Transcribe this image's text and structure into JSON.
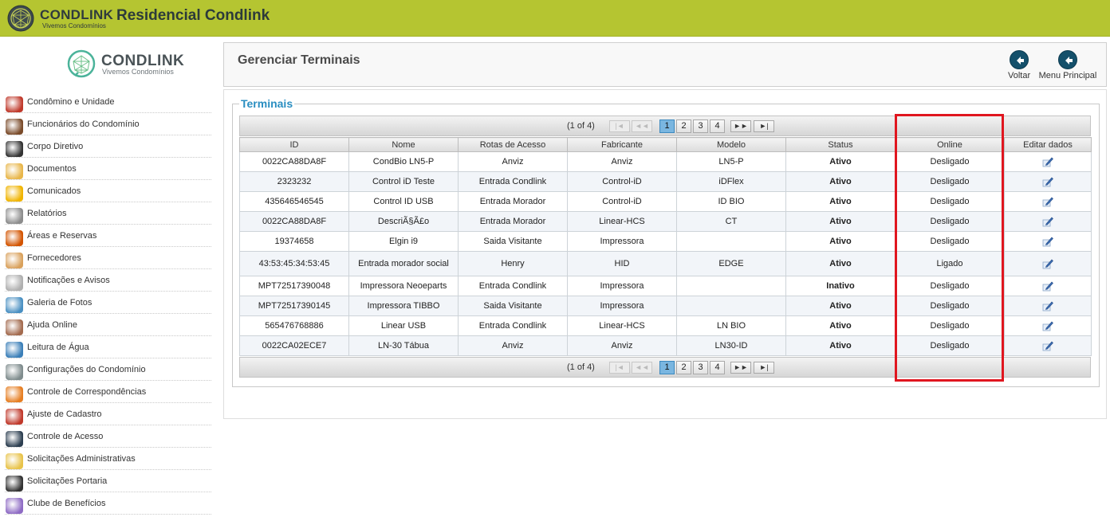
{
  "topbar": {
    "brand_name": "CONDLINK",
    "brand_tagline": "Vivemos Condomínios",
    "title": "Residencial Condlink"
  },
  "sidebar": {
    "logo_name": "CONDLINK",
    "logo_tagline": "Vivemos Condomínios",
    "items": [
      {
        "label": "Condômino e Unidade",
        "icon": "people-house-icon",
        "color": "#c0392b"
      },
      {
        "label": "Funcionários do Condomínio",
        "icon": "staff-icon",
        "color": "#7a4b2a"
      },
      {
        "label": "Corpo Diretivo",
        "icon": "director-icon",
        "color": "#333333"
      },
      {
        "label": "Documentos",
        "icon": "folder-icon",
        "color": "#e8b64a"
      },
      {
        "label": "Comunicados",
        "icon": "alert-icon",
        "color": "#f0b400"
      },
      {
        "label": "Relatórios",
        "icon": "report-icon",
        "color": "#8c8c8c"
      },
      {
        "label": "Áreas e Reservas",
        "icon": "calendar-icon",
        "color": "#d35400"
      },
      {
        "label": "Fornecedores",
        "icon": "handshake-icon",
        "color": "#d9a15c"
      },
      {
        "label": "Notificações e Avisos",
        "icon": "notification-icon",
        "color": "#b0b0b0"
      },
      {
        "label": "Galeria de Fotos",
        "icon": "photos-icon",
        "color": "#4a90c2"
      },
      {
        "label": "Ajuda Online",
        "icon": "help-icon",
        "color": "#a36b4f"
      },
      {
        "label": "Leitura de Água",
        "icon": "water-icon",
        "color": "#3b7fb8"
      },
      {
        "label": "Configurações do Condomínio",
        "icon": "settings-icon",
        "color": "#7f8c8d"
      },
      {
        "label": "Controle de Correspondências",
        "icon": "mail-icon",
        "color": "#e67e22"
      },
      {
        "label": "Ajuste de Cadastro",
        "icon": "briefcase-icon",
        "color": "#c0392b"
      },
      {
        "label": "Controle de Acesso",
        "icon": "access-icon",
        "color": "#2c3e50"
      },
      {
        "label": "Solicitações Administrativas",
        "icon": "request-icon",
        "color": "#e8c34a"
      },
      {
        "label": "Solicitações Portaria",
        "icon": "pen-icon",
        "color": "#333333"
      },
      {
        "label": "Clube de Benefícios",
        "icon": "gift-icon",
        "color": "#8e6bc4"
      }
    ]
  },
  "header": {
    "page_title": "Gerenciar Terminais",
    "back_label": "Voltar",
    "main_menu_label": "Menu Principal"
  },
  "section": {
    "legend": "Terminais"
  },
  "pager": {
    "info": "(1 of 4)",
    "first": "|◄",
    "prev": "◄◄",
    "next": "►►",
    "last": "►|",
    "pages": [
      "1",
      "2",
      "3",
      "4"
    ],
    "current_page": "1"
  },
  "table": {
    "columns": [
      "ID",
      "Nome",
      "Rotas de Acesso",
      "Fabricante",
      "Modelo",
      "Status",
      "Online",
      "Editar dados"
    ],
    "rows": [
      {
        "id": "0022CA88DA8F",
        "nome": "CondBio LN5-P",
        "rotas": "Anviz",
        "fabricante": "Anviz",
        "modelo": "LN5-P",
        "status": "Ativo",
        "online": "Desligado"
      },
      {
        "id": "2323232",
        "nome": "Control iD Teste",
        "rotas": "Entrada Condlink",
        "fabricante": "Control-iD",
        "modelo": "iDFlex",
        "status": "Ativo",
        "online": "Desligado"
      },
      {
        "id": "435646546545",
        "nome": "Control ID USB",
        "rotas": "Entrada Morador",
        "fabricante": "Control-iD",
        "modelo": "ID BIO",
        "status": "Ativo",
        "online": "Desligado"
      },
      {
        "id": "0022CA88DA8F",
        "nome": "DescriÃ§Ã£o",
        "rotas": "Entrada Morador",
        "fabricante": "Linear-HCS",
        "modelo": "CT",
        "status": "Ativo",
        "online": "Desligado"
      },
      {
        "id": "19374658",
        "nome": "Elgin i9",
        "rotas": "Saida Visitante",
        "fabricante": "Impressora",
        "modelo": "",
        "status": "Ativo",
        "online": "Desligado"
      },
      {
        "id": "43:53:45:34:53:45",
        "nome": "Entrada morador social",
        "rotas": "Henry",
        "fabricante": "HID",
        "modelo": "EDGE",
        "status": "Ativo",
        "online": "Ligado"
      },
      {
        "id": "MPT72517390048",
        "nome": "Impressora Neoeparts",
        "rotas": "Entrada Condlink",
        "fabricante": "Impressora",
        "modelo": "",
        "status": "Inativo",
        "online": "Desligado"
      },
      {
        "id": "MPT72517390145",
        "nome": "Impressora TIBBO",
        "rotas": "Saida Visitante",
        "fabricante": "Impressora",
        "modelo": "",
        "status": "Ativo",
        "online": "Desligado"
      },
      {
        "id": "565476768886",
        "nome": "Linear USB",
        "rotas": "Entrada Condlink",
        "fabricante": "Linear-HCS",
        "modelo": "LN BIO",
        "status": "Ativo",
        "online": "Desligado"
      },
      {
        "id": "0022CA02ECE7",
        "nome": "LN-30 Tábua",
        "rotas": "Anviz",
        "fabricante": "Anviz",
        "modelo": "LN30-ID",
        "status": "Ativo",
        "online": "Desligado"
      }
    ]
  },
  "colors": {
    "topbar": "#b5c531",
    "accent_blue": "#2a8ec1",
    "status_active": "#22a722",
    "status_inactive": "#cc1f1f",
    "highlight": "#e0161f"
  }
}
